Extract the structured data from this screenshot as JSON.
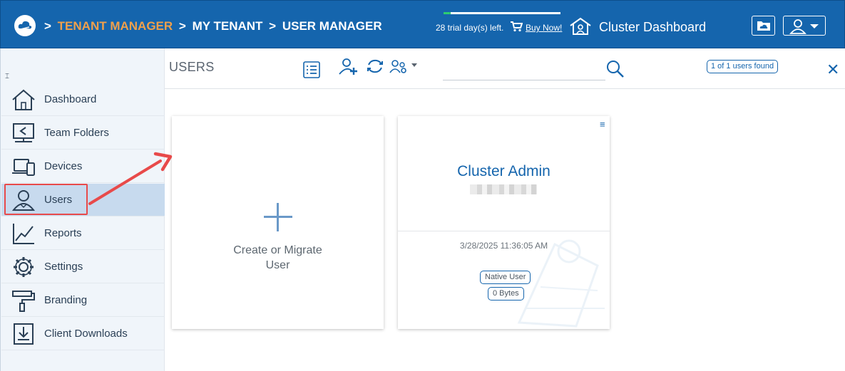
{
  "header": {
    "breadcrumbs": [
      {
        "sep": ">",
        "label": "TENANT MANAGER",
        "style": "active"
      },
      {
        "sep": ">",
        "label": "MY TENANT",
        "style": "plain"
      },
      {
        "sep": ">",
        "label": "USER MANAGER",
        "style": "plain"
      }
    ],
    "trial_text": "28 trial day(s) left.",
    "trial_progress": 0.06,
    "buy_now": "Buy Now!",
    "cluster_dashboard": "Cluster Dashboard",
    "icons": {
      "logo": "cloud-logo-icon",
      "cart": "cart-icon",
      "cluster": "house-users-icon",
      "folder": "cloud-folder-icon",
      "user": "user-account-icon"
    }
  },
  "sidebar": {
    "items": [
      {
        "label": "Dashboard",
        "icon": "home-icon"
      },
      {
        "label": "Team Folders",
        "icon": "shared-folder-icon"
      },
      {
        "label": "Devices",
        "icon": "devices-icon"
      },
      {
        "label": "Users",
        "icon": "user-icon",
        "active": true
      },
      {
        "label": "Reports",
        "icon": "chart-icon"
      },
      {
        "label": "Settings",
        "icon": "gear-icon"
      },
      {
        "label": "Branding",
        "icon": "paint-roller-icon"
      },
      {
        "label": "Client Downloads",
        "icon": "download-icon"
      }
    ]
  },
  "toolbar": {
    "title": "USERS",
    "found": "1 of 1 users found",
    "search_placeholder": ""
  },
  "cards": {
    "create": {
      "label_line1": "Create or Migrate",
      "label_line2": "User"
    },
    "user": {
      "name": "Cluster Admin",
      "date": "3/28/2025 11:36:05 AM",
      "type": "Native User",
      "size": "0 Bytes"
    }
  },
  "colors": {
    "header_bg": "#1565ad",
    "accent_orange": "#f0a04b",
    "sidebar_active": "#c7daee",
    "annotation_red": "#e84a4a"
  }
}
